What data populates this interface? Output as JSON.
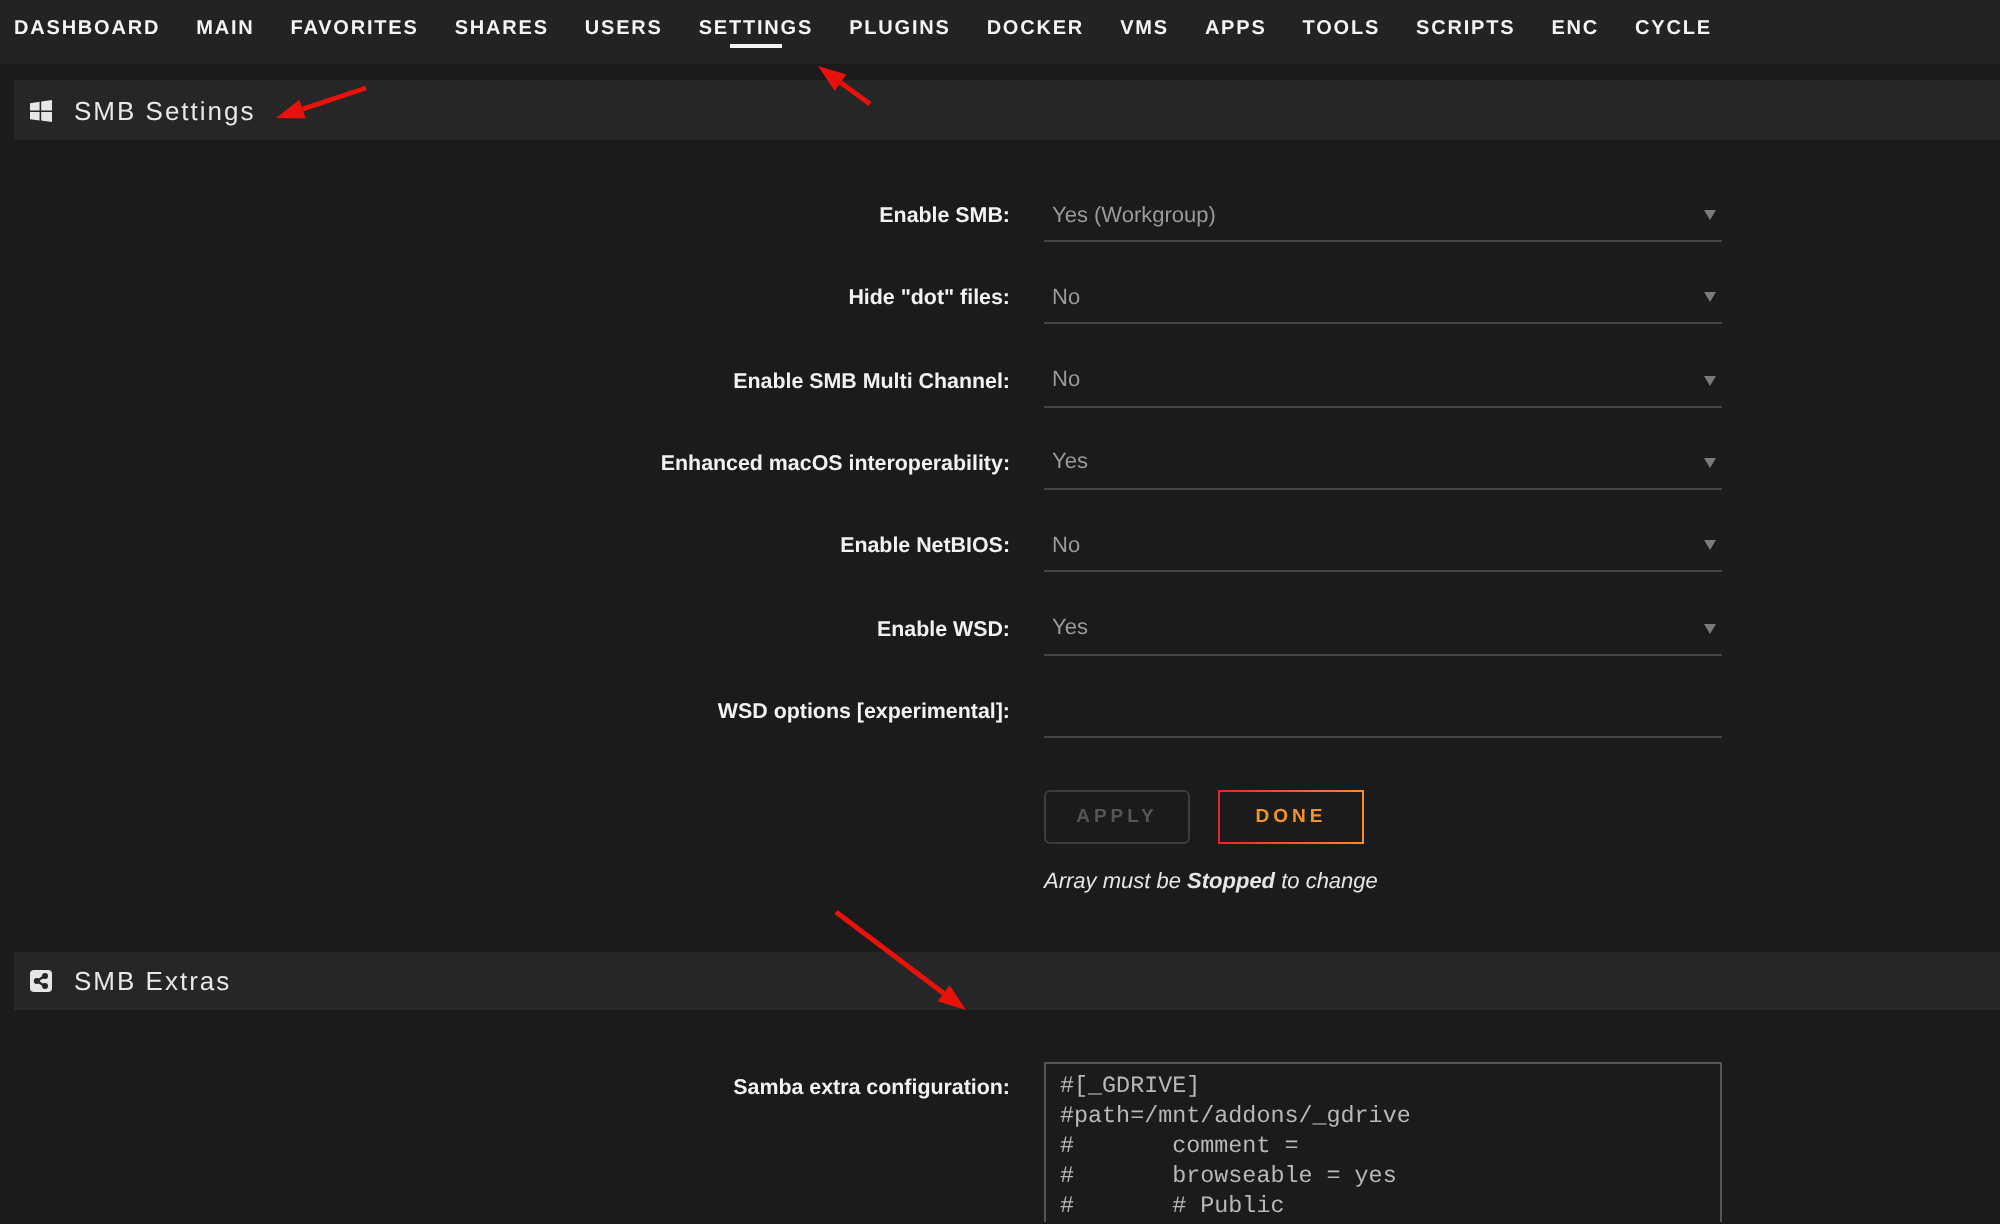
{
  "nav": {
    "tabs": [
      {
        "label": "DASHBOARD",
        "selected": false
      },
      {
        "label": "MAIN",
        "selected": false
      },
      {
        "label": "FAVORITES",
        "selected": false
      },
      {
        "label": "SHARES",
        "selected": false
      },
      {
        "label": "USERS",
        "selected": false
      },
      {
        "label": "SETTINGS",
        "selected": true
      },
      {
        "label": "PLUGINS",
        "selected": false
      },
      {
        "label": "DOCKER",
        "selected": false
      },
      {
        "label": "VMS",
        "selected": false
      },
      {
        "label": "APPS",
        "selected": false
      },
      {
        "label": "TOOLS",
        "selected": false
      },
      {
        "label": "SCRIPTS",
        "selected": false
      },
      {
        "label": "ENC",
        "selected": false
      },
      {
        "label": "CYCLE",
        "selected": false
      }
    ]
  },
  "smb_settings": {
    "title": "SMB Settings",
    "fields": [
      {
        "label": "Enable SMB:",
        "kind": "select",
        "value": "Yes (Workgroup)"
      },
      {
        "label": "Hide \"dot\" files:",
        "kind": "select",
        "value": "No"
      },
      {
        "label": "Enable SMB Multi Channel:",
        "kind": "select",
        "value": "No"
      },
      {
        "label": "Enhanced macOS interoperability:",
        "kind": "select",
        "value": "Yes"
      },
      {
        "label": "Enable NetBIOS:",
        "kind": "select",
        "value": "No"
      },
      {
        "label": "Enable WSD:",
        "kind": "select",
        "value": "Yes"
      },
      {
        "label": "WSD options [experimental]:",
        "kind": "input"
      }
    ],
    "buttons": [
      {
        "label": "APPLY",
        "disabled": true
      },
      {
        "label": "DONE",
        "disabled": false
      }
    ],
    "note": "Array must be **Stopped** to change"
  },
  "smb_extras": {
    "title": "SMB Extras",
    "fields": [
      {
        "label": "Samba extra configuration:",
        "kind": "textarea",
        "lines": [
          "#[_GDRIVE]",
          "#path=/mnt/addons/_gdrive",
          "#       comment =",
          "#       browseable = yes",
          "#       # Public"
        ]
      }
    ]
  }
}
